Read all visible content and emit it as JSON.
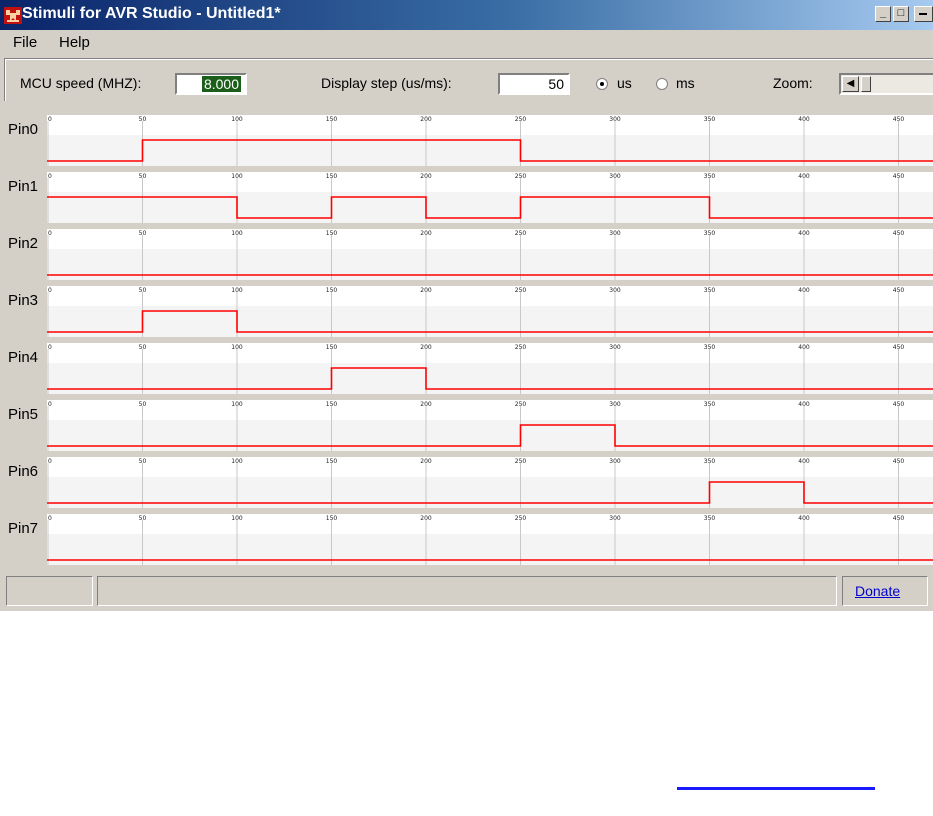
{
  "window": {
    "title": "Stimuli for AVR Studio - Untitled1*",
    "controls": {
      "minimize": "_",
      "maximize": "□"
    }
  },
  "menu": {
    "items": [
      "File",
      "Help"
    ]
  },
  "toolbar": {
    "mcu_speed_label": "MCU speed (MHZ):",
    "mcu_speed_value": "8.000",
    "display_step_label": "Display step (us/ms):",
    "display_step_value": "50",
    "unit_us_label": "us",
    "unit_ms_label": "ms",
    "selected_unit": "us",
    "zoom_label": "Zoom:"
  },
  "timeline": {
    "tick_labels": [
      "0",
      "50",
      "100",
      "150",
      "200",
      "250",
      "300",
      "350",
      "400",
      "450"
    ],
    "tick_step": 50,
    "max_time": 450,
    "signal_color": "#ff0000",
    "grid_color": "#c8c8c8"
  },
  "channels": [
    {
      "label": "Pin0",
      "high_intervals": [
        [
          50,
          250
        ]
      ]
    },
    {
      "label": "Pin1",
      "high_intervals": [
        [
          0,
          100
        ],
        [
          150,
          200
        ],
        [
          250,
          350
        ]
      ]
    },
    {
      "label": "Pin2",
      "high_intervals": []
    },
    {
      "label": "Pin3",
      "high_intervals": [
        [
          50,
          100
        ]
      ]
    },
    {
      "label": "Pin4",
      "high_intervals": [
        [
          150,
          200
        ]
      ]
    },
    {
      "label": "Pin5",
      "high_intervals": [
        [
          250,
          300
        ]
      ]
    },
    {
      "label": "Pin6",
      "high_intervals": [
        [
          350,
          400
        ]
      ]
    },
    {
      "label": "Pin7",
      "high_intervals": []
    }
  ],
  "statusbar": {
    "donate_label": "Donate"
  }
}
